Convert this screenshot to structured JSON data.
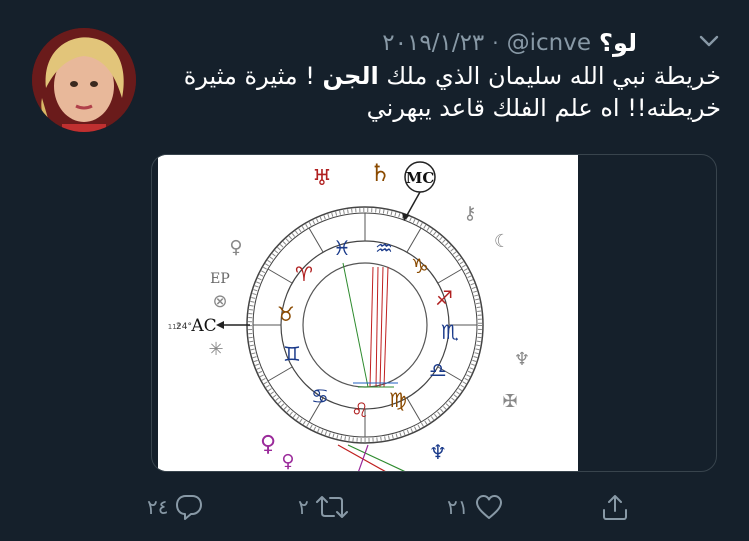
{
  "tweet": {
    "display_name": "لو؟",
    "handle": "@icnve",
    "separator": "·",
    "date": "٢٠١٩/١/٢٣",
    "text_part1": "خريطة نبي الله سليمان الذي ملك ",
    "text_bold": "الجن",
    "text_part2": " ! مثيرة مثيرة خريطته!! اه علم الفلك قاعد يبهرني"
  },
  "chart": {
    "mc_label": "MC",
    "ac_label": "AC",
    "ep_label": "EP",
    "ac_degree": "24°",
    "ac_pos": "11°"
  },
  "actions": {
    "reply_count": "٢٤",
    "retweet_count": "٢",
    "like_count": "٢١"
  },
  "icons": {
    "caret": "chevron-down-icon",
    "reply": "reply-icon",
    "retweet": "retweet-icon",
    "like": "heart-icon",
    "share": "share-icon"
  },
  "colors": {
    "background": "#15202b",
    "secondary_text": "#8899a6",
    "border": "#38444d"
  }
}
